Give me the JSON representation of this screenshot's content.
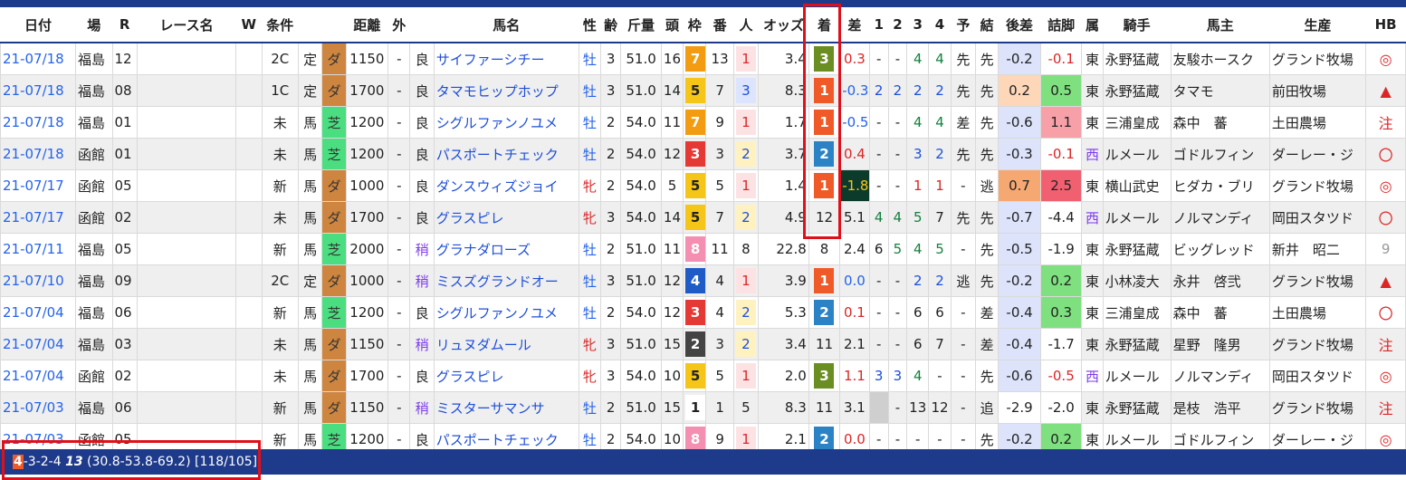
{
  "headers": [
    "日付",
    "場",
    "R",
    "レース名",
    "W",
    "条件",
    "",
    "",
    "距離",
    "外",
    "",
    "馬名",
    "性",
    "齢",
    "斤量",
    "頭",
    "枠",
    "番",
    "人",
    "オッズ",
    "着",
    "差",
    "1",
    "2",
    "3",
    "4",
    "予",
    "結",
    "後差",
    "詰脚",
    "属",
    "騎手",
    "馬主",
    "生産",
    "HB"
  ],
  "colors": {
    "header_rule": "#1e3a8a",
    "dirt": "#cd853f",
    "turf": "#4ade80",
    "pos1": "#f05a28",
    "pos2": "#2b83c6",
    "pos3": "#6b8e23"
  },
  "rows": [
    {
      "date": "21-07/18",
      "venue": "福島",
      "r": "12",
      "name": "",
      "w": "",
      "cond": "2C",
      "cond2": "定",
      "surface": "ダ",
      "dist": "1150",
      "out": "-",
      "track": "良",
      "horse": "サイファーシチー",
      "sex": "牡",
      "age": "3",
      "kg": "51.0",
      "heads": "16",
      "waku": "7",
      "ban": "13",
      "pop": "1",
      "odds": "3.4",
      "rank": "3",
      "diff": "0.3",
      "c1": "-",
      "c2": "-",
      "c3": "4",
      "c4": "4",
      "pred": "先",
      "result": "先",
      "after": "-0.2",
      "tsume": "-0.1",
      "zoku": "東",
      "jockey": "永野猛蔵",
      "owner": "友駿ホースク",
      "breeder": "グランド牧場",
      "hb": "◎"
    },
    {
      "date": "21-07/18",
      "venue": "福島",
      "r": "08",
      "name": "",
      "w": "",
      "cond": "1C",
      "cond2": "定",
      "surface": "ダ",
      "dist": "1700",
      "out": "-",
      "track": "良",
      "horse": "タマモヒップホップ",
      "sex": "牡",
      "age": "3",
      "kg": "51.0",
      "heads": "14",
      "waku": "5",
      "ban": "7",
      "pop": "3",
      "odds": "8.3",
      "rank": "1",
      "diff": "-0.3",
      "c1": "2",
      "c2": "2",
      "c3": "2",
      "c4": "2",
      "pred": "先",
      "result": "先",
      "after": "0.2",
      "tsume": "0.5",
      "zoku": "東",
      "jockey": "永野猛蔵",
      "owner": "タマモ",
      "breeder": "前田牧場",
      "hb": "▲"
    },
    {
      "date": "21-07/18",
      "venue": "福島",
      "r": "01",
      "name": "",
      "w": "",
      "cond": "未",
      "cond2": "馬",
      "surface": "芝",
      "dist": "1200",
      "out": "-",
      "track": "良",
      "horse": "シグルファンノユメ",
      "sex": "牡",
      "age": "2",
      "kg": "54.0",
      "heads": "11",
      "waku": "7",
      "ban": "9",
      "pop": "1",
      "odds": "1.7",
      "rank": "1",
      "diff": "-0.5",
      "c1": "-",
      "c2": "-",
      "c3": "4",
      "c4": "4",
      "pred": "差",
      "result": "先",
      "after": "-0.6",
      "tsume": "1.1",
      "zoku": "東",
      "jockey": "三浦皇成",
      "owner": "森中　蕃",
      "breeder": "土田農場",
      "hb": "注"
    },
    {
      "date": "21-07/18",
      "venue": "函館",
      "r": "01",
      "name": "",
      "w": "",
      "cond": "未",
      "cond2": "馬",
      "surface": "芝",
      "dist": "1200",
      "out": "-",
      "track": "良",
      "horse": "パスポートチェック",
      "sex": "牡",
      "age": "2",
      "kg": "54.0",
      "heads": "12",
      "waku": "3",
      "ban": "3",
      "pop": "2",
      "odds": "3.7",
      "rank": "2",
      "diff": "0.4",
      "c1": "-",
      "c2": "-",
      "c3": "3",
      "c4": "2",
      "pred": "先",
      "result": "先",
      "after": "-0.3",
      "tsume": "-0.1",
      "zoku": "西",
      "jockey": "ルメール",
      "owner": "ゴドルフィン",
      "breeder": "ダーレー・ジ",
      "hb": "〇"
    },
    {
      "date": "21-07/17",
      "venue": "函館",
      "r": "05",
      "name": "",
      "w": "",
      "cond": "新",
      "cond2": "馬",
      "surface": "ダ",
      "dist": "1000",
      "out": "-",
      "track": "良",
      "horse": "ダンスウィズジョイ",
      "sex": "牝",
      "age": "2",
      "kg": "54.0",
      "heads": "5",
      "waku": "5",
      "ban": "5",
      "pop": "1",
      "odds": "1.4",
      "rank": "1",
      "diff": "-1.8",
      "c1": "-",
      "c2": "-",
      "c3": "1",
      "c4": "1",
      "pred": "-",
      "result": "逃",
      "after": "0.7",
      "tsume": "2.5",
      "zoku": "東",
      "jockey": "横山武史",
      "owner": "ヒダカ・ブリ",
      "breeder": "グランド牧場",
      "hb": "◎"
    },
    {
      "date": "21-07/17",
      "venue": "函館",
      "r": "02",
      "name": "",
      "w": "",
      "cond": "未",
      "cond2": "馬",
      "surface": "ダ",
      "dist": "1700",
      "out": "-",
      "track": "良",
      "horse": "グラスピレ",
      "sex": "牝",
      "age": "3",
      "kg": "54.0",
      "heads": "14",
      "waku": "5",
      "ban": "7",
      "pop": "2",
      "odds": "4.9",
      "rank": "12",
      "diff": "5.1",
      "c1": "4",
      "c2": "4",
      "c3": "5",
      "c4": "7",
      "pred": "先",
      "result": "先",
      "after": "-0.7",
      "tsume": "-4.4",
      "zoku": "西",
      "jockey": "ルメール",
      "owner": "ノルマンディ",
      "breeder": "岡田スタツド",
      "hb": "〇"
    },
    {
      "date": "21-07/11",
      "venue": "福島",
      "r": "05",
      "name": "",
      "w": "",
      "cond": "新",
      "cond2": "馬",
      "surface": "芝",
      "dist": "2000",
      "out": "-",
      "track": "稍",
      "horse": "グラナダローズ",
      "sex": "牡",
      "age": "2",
      "kg": "51.0",
      "heads": "11",
      "waku": "8",
      "ban": "11",
      "pop": "8",
      "odds": "22.8",
      "rank": "8",
      "diff": "2.4",
      "c1": "6",
      "c2": "5",
      "c3": "4",
      "c4": "5",
      "pred": "-",
      "result": "先",
      "after": "-0.5",
      "tsume": "-1.9",
      "zoku": "東",
      "jockey": "永野猛蔵",
      "owner": "ビッグレッド",
      "breeder": "新井　昭二",
      "hb": "9"
    },
    {
      "date": "21-07/10",
      "venue": "福島",
      "r": "09",
      "name": "",
      "w": "",
      "cond": "2C",
      "cond2": "定",
      "surface": "ダ",
      "dist": "1000",
      "out": "-",
      "track": "稍",
      "horse": "ミスズグランドオー",
      "sex": "牡",
      "age": "3",
      "kg": "51.0",
      "heads": "12",
      "waku": "4",
      "ban": "4",
      "pop": "1",
      "odds": "3.9",
      "rank": "1",
      "diff": "0.0",
      "c1": "-",
      "c2": "-",
      "c3": "2",
      "c4": "2",
      "pred": "逃",
      "result": "先",
      "after": "-0.2",
      "tsume": "0.2",
      "zoku": "東",
      "jockey": "小林凌大",
      "owner": "永井　啓弐",
      "breeder": "グランド牧場",
      "hb": "▲"
    },
    {
      "date": "21-07/04",
      "venue": "福島",
      "r": "06",
      "name": "",
      "w": "",
      "cond": "新",
      "cond2": "馬",
      "surface": "芝",
      "dist": "1200",
      "out": "-",
      "track": "良",
      "horse": "シグルファンノユメ",
      "sex": "牡",
      "age": "2",
      "kg": "54.0",
      "heads": "12",
      "waku": "3",
      "ban": "4",
      "pop": "2",
      "odds": "5.3",
      "rank": "2",
      "diff": "0.1",
      "c1": "-",
      "c2": "-",
      "c3": "6",
      "c4": "6",
      "pred": "-",
      "result": "差",
      "after": "-0.4",
      "tsume": "0.3",
      "zoku": "東",
      "jockey": "三浦皇成",
      "owner": "森中　蕃",
      "breeder": "土田農場",
      "hb": "〇"
    },
    {
      "date": "21-07/04",
      "venue": "福島",
      "r": "03",
      "name": "",
      "w": "",
      "cond": "未",
      "cond2": "馬",
      "surface": "ダ",
      "dist": "1150",
      "out": "-",
      "track": "稍",
      "horse": "リュヌダムール",
      "sex": "牝",
      "age": "3",
      "kg": "51.0",
      "heads": "15",
      "waku": "2",
      "ban": "3",
      "pop": "2",
      "odds": "3.4",
      "rank": "11",
      "diff": "2.1",
      "c1": "-",
      "c2": "-",
      "c3": "6",
      "c4": "7",
      "pred": "-",
      "result": "差",
      "after": "-0.4",
      "tsume": "-1.7",
      "zoku": "東",
      "jockey": "永野猛蔵",
      "owner": "星野　隆男",
      "breeder": "グランド牧場",
      "hb": "注"
    },
    {
      "date": "21-07/04",
      "venue": "函館",
      "r": "02",
      "name": "",
      "w": "",
      "cond": "未",
      "cond2": "馬",
      "surface": "ダ",
      "dist": "1700",
      "out": "-",
      "track": "良",
      "horse": "グラスピレ",
      "sex": "牝",
      "age": "3",
      "kg": "54.0",
      "heads": "10",
      "waku": "5",
      "ban": "5",
      "pop": "1",
      "odds": "2.0",
      "rank": "3",
      "diff": "1.1",
      "c1": "3",
      "c2": "3",
      "c3": "4",
      "c4": "-",
      "pred": "-",
      "result": "先",
      "after": "-0.6",
      "tsume": "-0.5",
      "zoku": "西",
      "jockey": "ルメール",
      "owner": "ノルマンディ",
      "breeder": "岡田スタツド",
      "hb": "◎"
    },
    {
      "date": "21-07/03",
      "venue": "福島",
      "r": "06",
      "name": "",
      "w": "",
      "cond": "新",
      "cond2": "馬",
      "surface": "ダ",
      "dist": "1150",
      "out": "-",
      "track": "稍",
      "horse": "ミスターサマンサ",
      "sex": "牡",
      "age": "2",
      "kg": "51.0",
      "heads": "15",
      "waku": "1",
      "ban": "1",
      "pop": "5",
      "odds": "8.3",
      "rank": "11",
      "diff": "3.1",
      "c1": "",
      "c2": "-",
      "c3": "13",
      "c4": "12",
      "pred": "-",
      "result": "追",
      "after": "-2.9",
      "tsume": "-2.0",
      "zoku": "東",
      "jockey": "永野猛蔵",
      "owner": "是枝　浩平",
      "breeder": "グランド牧場",
      "hb": "注"
    },
    {
      "date": "21-07/03",
      "venue": "函館",
      "r": "05",
      "name": "",
      "w": "",
      "cond": "新",
      "cond2": "馬",
      "surface": "芝",
      "dist": "1200",
      "out": "-",
      "track": "良",
      "horse": "パスポートチェック",
      "sex": "牡",
      "age": "2",
      "kg": "54.0",
      "heads": "10",
      "waku": "8",
      "ban": "9",
      "pop": "1",
      "odds": "2.1",
      "rank": "2",
      "diff": "0.0",
      "c1": "-",
      "c2": "-",
      "c3": "-",
      "c4": "-",
      "pred": "-",
      "result": "先",
      "after": "-0.2",
      "tsume": "0.2",
      "zoku": "東",
      "jockey": "ルメール",
      "owner": "ゴドルフィン",
      "breeder": "ダーレー・ジ",
      "hb": "◎"
    }
  ],
  "footer": {
    "first": "4",
    "rest": "-3-2-4 ",
    "bold": "13",
    "stats": " (30.8-53.8-69.2) [118/105]"
  }
}
